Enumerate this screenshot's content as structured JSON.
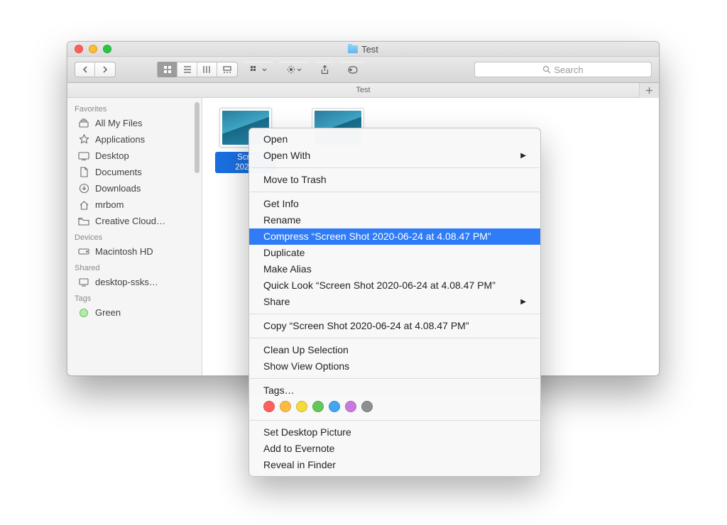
{
  "window": {
    "title": "Test"
  },
  "toolbar": {
    "search_placeholder": "Search"
  },
  "pathbar": {
    "label": "Test"
  },
  "sidebar": {
    "sections": {
      "favorites_label": "Favorites",
      "devices_label": "Devices",
      "shared_label": "Shared",
      "tags_label": "Tags"
    },
    "favorites": [
      {
        "label": "All My Files"
      },
      {
        "label": "Applications"
      },
      {
        "label": "Desktop"
      },
      {
        "label": "Documents"
      },
      {
        "label": "Downloads"
      },
      {
        "label": "mrbom"
      },
      {
        "label": "Creative Cloud…"
      }
    ],
    "devices": [
      {
        "label": "Macintosh HD"
      }
    ],
    "shared": [
      {
        "label": "desktop-ssks…"
      }
    ],
    "tags": [
      {
        "label": "Green",
        "color": "#63c657"
      }
    ]
  },
  "files": [
    {
      "name_line1": "Scre",
      "name_line2": "2020-",
      "selected": true
    },
    {
      "name_line1": "",
      "name_line2": "",
      "selected": false
    }
  ],
  "context_menu": {
    "open": "Open",
    "open_with": "Open With",
    "move_to_trash": "Move to Trash",
    "get_info": "Get Info",
    "rename": "Rename",
    "compress": "Compress “Screen Shot 2020-06-24 at 4.08.47 PM”",
    "duplicate": "Duplicate",
    "make_alias": "Make Alias",
    "quick_look": "Quick Look “Screen Shot 2020-06-24 at 4.08.47 PM”",
    "share": "Share",
    "copy": "Copy “Screen Shot 2020-06-24 at 4.08.47 PM”",
    "clean_up": "Clean Up Selection",
    "view_options": "Show View Options",
    "tags_label": "Tags…",
    "tag_colors": [
      "#fc605c",
      "#fdbc40",
      "#f6d93a",
      "#63c657",
      "#42a7f0",
      "#c979dd",
      "#8e8e93"
    ],
    "set_desktop": "Set Desktop Picture",
    "add_evernote": "Add to Evernote",
    "reveal": "Reveal in Finder"
  }
}
